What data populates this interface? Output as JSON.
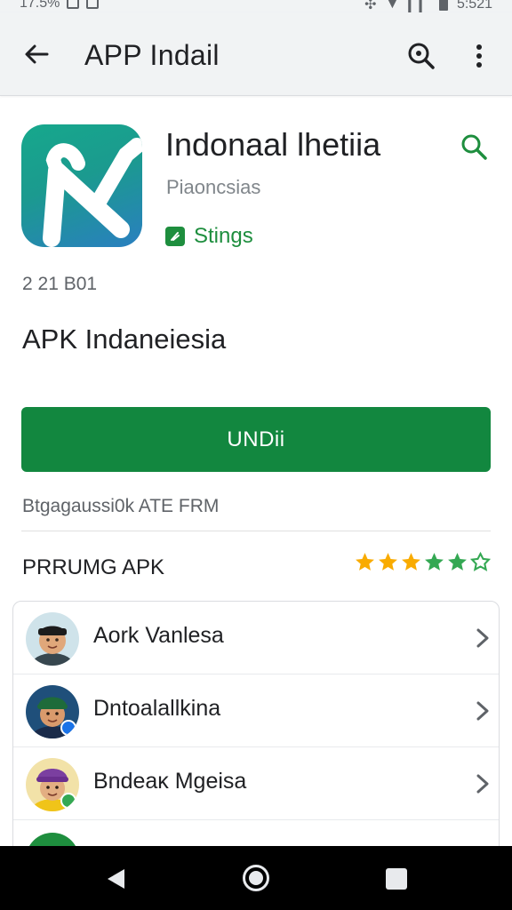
{
  "status_bar": {
    "left_text": "17.5%",
    "right_text": "5:521",
    "icons": [
      "notification-icon",
      "notification-icon",
      "signal-icon",
      "wifi-icon",
      "battery-icon"
    ]
  },
  "app_bar": {
    "title": "APP Indail",
    "icons": [
      "back-arrow-icon",
      "search-icon",
      "more-vert-icon"
    ]
  },
  "app": {
    "name": "Indonaal lhetiia",
    "developer": "Piaoncsias",
    "tag_label": "Stings",
    "meta_code": "2 21 B01",
    "subtitle": "APK Indaneiesia",
    "install_label": "UNDii",
    "notice": "Btgagaussi0k ATE FRM",
    "brand_color": "#12873f",
    "accent_color": "#1e8e3e"
  },
  "section": {
    "title": "PRRUMG APK",
    "rating_stars": 5,
    "star_colors": [
      "#f9ab00",
      "#f9ab00",
      "#f9ab00",
      "#34a853",
      "#34a853",
      "#34a853"
    ]
  },
  "list": {
    "items": [
      {
        "label": "Aork Vanlesa",
        "avatar": "avatar-boy-black-cap"
      },
      {
        "label": "Dntoalallkina",
        "avatar": "avatar-boy-green-cap"
      },
      {
        "label": "Bndeaĸ Mgeisa",
        "avatar": "avatar-boy-purple-cap"
      }
    ]
  },
  "nav_bar": {
    "icons": [
      "nav-back-icon",
      "nav-home-icon",
      "nav-recent-icon"
    ]
  }
}
